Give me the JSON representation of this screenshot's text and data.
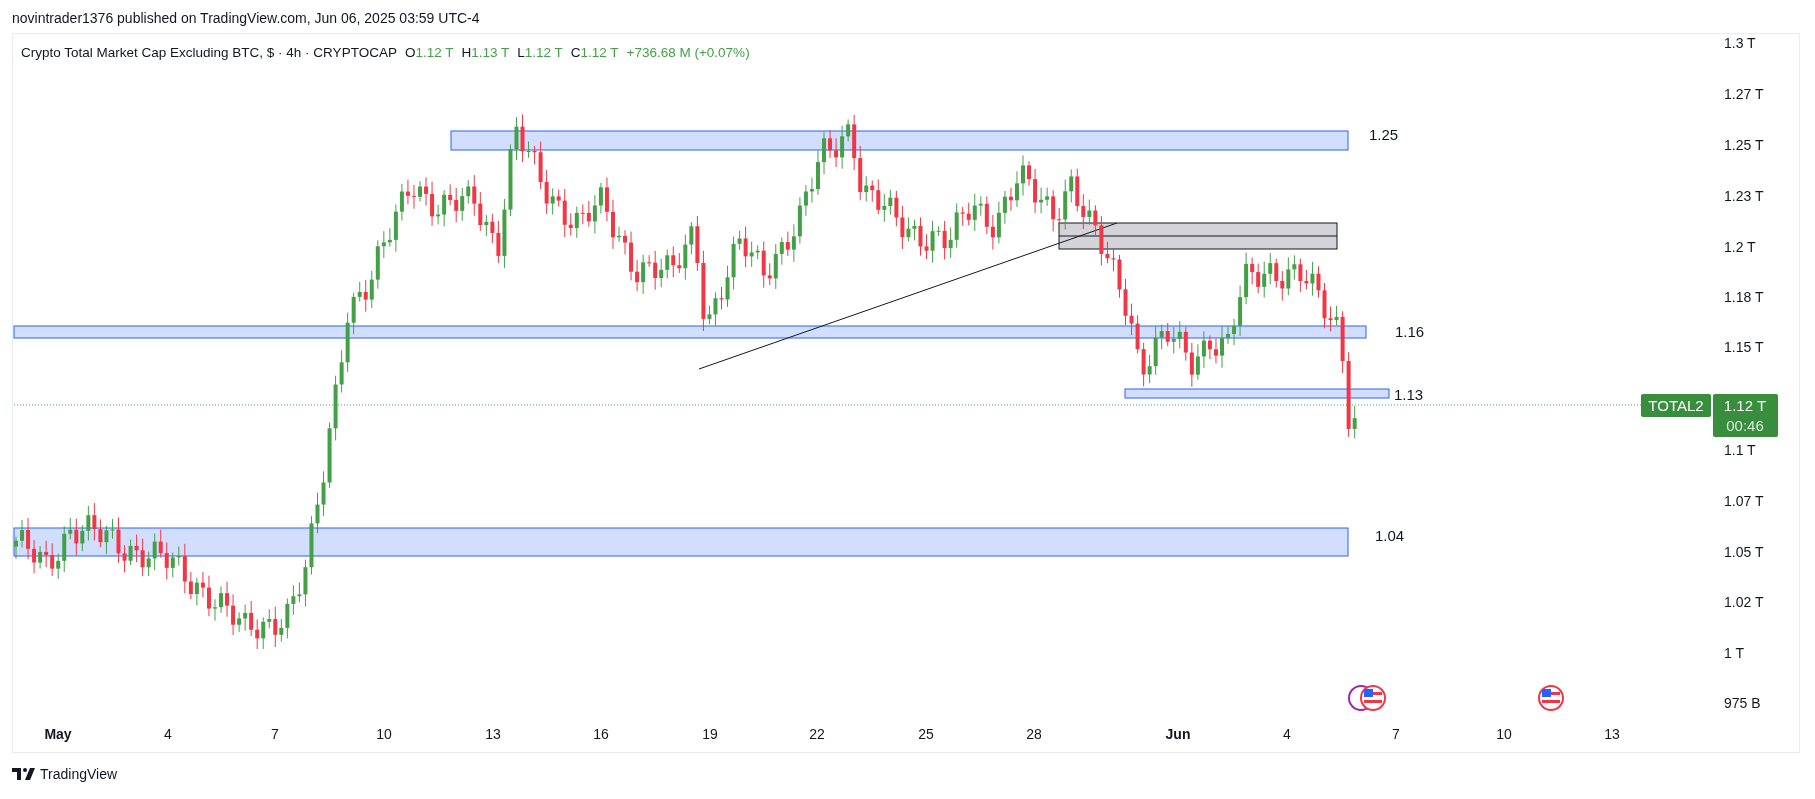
{
  "header": {
    "byline": "novintrader1376 published on TradingView.com, Jun 06, 2025 03:59 UTC-4"
  },
  "legend": {
    "title": "Crypto Total Market Cap Excluding BTC, $ · 4h · CRYPTOCAP",
    "ohlc": [
      {
        "letter": "O",
        "value": "1.12 T"
      },
      {
        "letter": "H",
        "value": "1.13 T"
      },
      {
        "letter": "L",
        "value": "1.12 T"
      },
      {
        "letter": "C",
        "value": "1.12 T"
      }
    ],
    "change": "+736.68 M (+0.07%)"
  },
  "chart": {
    "zones": [
      {
        "label": "1.25"
      },
      {
        "label": "1.16"
      },
      {
        "label": "1.13"
      },
      {
        "label": "1.04"
      }
    ],
    "price_axis": [
      "1.3 T",
      "1.27 T",
      "1.25 T",
      "1.23 T",
      "1.2 T",
      "1.18 T",
      "1.15 T",
      "1.1 T",
      "1.07 T",
      "1.05 T",
      "1.02 T",
      "1 T",
      "975 B"
    ],
    "time_axis": [
      {
        "label": "May",
        "bold": true
      },
      {
        "label": "4",
        "bold": false
      },
      {
        "label": "7",
        "bold": false
      },
      {
        "label": "10",
        "bold": false
      },
      {
        "label": "13",
        "bold": false
      },
      {
        "label": "16",
        "bold": false
      },
      {
        "label": "19",
        "bold": false
      },
      {
        "label": "22",
        "bold": false
      },
      {
        "label": "25",
        "bold": false
      },
      {
        "label": "28",
        "bold": false
      },
      {
        "label": "Jun",
        "bold": true
      },
      {
        "label": "4",
        "bold": false
      },
      {
        "label": "7",
        "bold": false
      },
      {
        "label": "10",
        "bold": false
      },
      {
        "label": "13",
        "bold": false
      }
    ],
    "symbol_tag": "TOTAL2",
    "price_tag": "1.12 T",
    "countdown": "00:46"
  },
  "footer": {
    "brand": "TradingView"
  }
}
